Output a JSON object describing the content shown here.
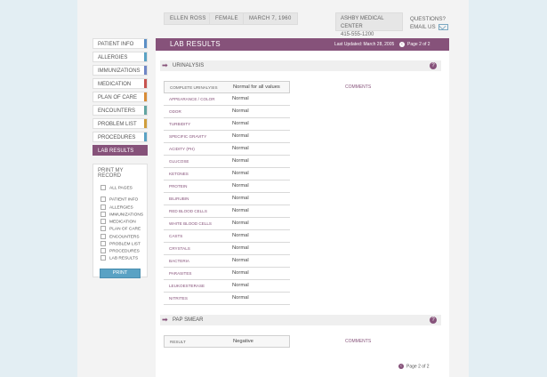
{
  "header": {
    "patient_name": "ELLEN ROSS",
    "gender": "FEMALE",
    "dob": "MARCH 7, 1960",
    "clinic_name": "ASHBY MEDICAL CENTER",
    "clinic_phone": "415-555-1200",
    "questions_label": "QUESTIONS?",
    "email_label": "EMAIL US",
    "email_icon": "envelope-icon"
  },
  "sidebar": {
    "items": [
      {
        "label": "PATIENT INFO",
        "color": "#5b8fc6"
      },
      {
        "label": "ALLERGIES",
        "color": "#5aa2c4"
      },
      {
        "label": "IMMUNIZATIONS",
        "color": "#6f86c6"
      },
      {
        "label": "MEDICATION",
        "color": "#c7534f"
      },
      {
        "label": "PLAN OF CARE",
        "color": "#d88c37"
      },
      {
        "label": "ENCOUNTERS",
        "color": "#62a5a1"
      },
      {
        "label": "PROBLEM LIST",
        "color": "#cf9e3c"
      },
      {
        "label": "PROCEDURES",
        "color": "#5aa2c4"
      },
      {
        "label": "LAB RESULTS",
        "color": "#86527a"
      }
    ],
    "active_index": 8
  },
  "print": {
    "title": "PRINT MY RECORD",
    "all_pages": "ALL PAGES",
    "options": [
      "PATIENT INFO",
      "ALLERGIES",
      "IMMUNIZATIONS",
      "MEDICATION",
      "PLAN OF CARE",
      "ENCOUNTERS",
      "PROBLEM LIST",
      "PROCEDURES",
      "LAB RESULTS"
    ],
    "button_label": "PRINT"
  },
  "main": {
    "title": "LAB RESULTS",
    "last_updated": "Last Updated: March 28, 2005",
    "pager": "Page 2 of 2",
    "bottom_pager": "Page 2 of 2"
  },
  "sections": {
    "urinalysis": {
      "title": "URINALYSIS",
      "comments_label": "COMMENTS",
      "rows": [
        {
          "name": "COMPLETE URINALYSIS",
          "value": "Normal for all values"
        },
        {
          "name": "APPEARANCE / COLOR",
          "value": "Normal"
        },
        {
          "name": "ODOR",
          "value": "Normal"
        },
        {
          "name": "TURBIDITY",
          "value": "Normal"
        },
        {
          "name": "SPECIFIC GRAVITY",
          "value": "Normal"
        },
        {
          "name": "ACIDITY (PH)",
          "value": "Normal"
        },
        {
          "name": "GLUCOSE",
          "value": "Normal"
        },
        {
          "name": "KETONES",
          "value": "Normal"
        },
        {
          "name": "PROTEIN",
          "value": "Normal"
        },
        {
          "name": "BILIRUBIN",
          "value": "Normal"
        },
        {
          "name": "RED BLOOD CELLS",
          "value": "Normal"
        },
        {
          "name": "WHITE BLOOD CELLS",
          "value": "Normal"
        },
        {
          "name": "CASTS",
          "value": "Normal"
        },
        {
          "name": "CRYSTALS",
          "value": "Normal"
        },
        {
          "name": "BACTERIA",
          "value": "Normal"
        },
        {
          "name": "PARASITES",
          "value": "Normal"
        },
        {
          "name": "LEUKOESTERASE",
          "value": "Normal"
        },
        {
          "name": "NITRITES",
          "value": "Normal"
        }
      ]
    },
    "pap_smear": {
      "title": "PAP SMEAR",
      "comments_label": "COMMENTS",
      "rows": [
        {
          "name": "RESULT",
          "value": "Negative"
        }
      ]
    }
  },
  "colors": {
    "accent": "#86527a",
    "background": "#e3eef3",
    "print_button": "#5aa2c4"
  }
}
